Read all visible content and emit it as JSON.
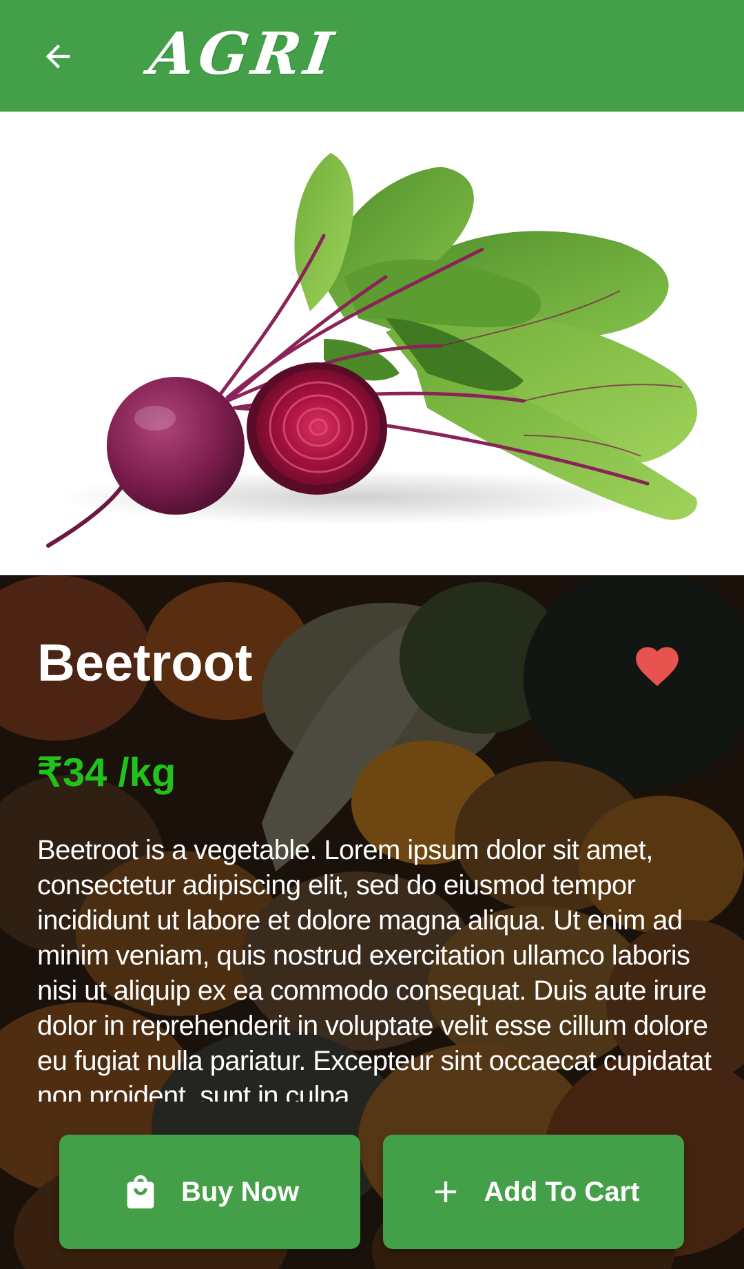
{
  "app": {
    "logo_text": "AGRI",
    "brand_color": "#43a048"
  },
  "header": {
    "back_icon": "arrow-left-icon"
  },
  "product": {
    "image_alt": "",
    "title": "Beetroot",
    "price": "₹34 /kg",
    "price_color": "#22c21c",
    "favorite_icon": "heart-icon",
    "favorite_color": "#e8534f",
    "description": "Beetroot is a vegetable. Lorem ipsum dolor sit amet, consectetur adipiscing elit, sed do eiusmod tempor incididunt ut labore et dolore magna aliqua. Ut enim ad minim veniam, quis nostrud exercitation ullamco laboris nisi ut aliquip ex ea commodo consequat. Duis aute irure dolor in reprehenderit in voluptate velit esse cillum dolore eu fugiat nulla pariatur. Excepteur sint occaecat cupidatat non proident, sunt in culpa"
  },
  "actions": {
    "buy_now_label": "Buy Now",
    "buy_now_icon": "shopping-bag-icon",
    "add_to_cart_label": "Add To Cart",
    "add_to_cart_icon": "plus-icon"
  }
}
